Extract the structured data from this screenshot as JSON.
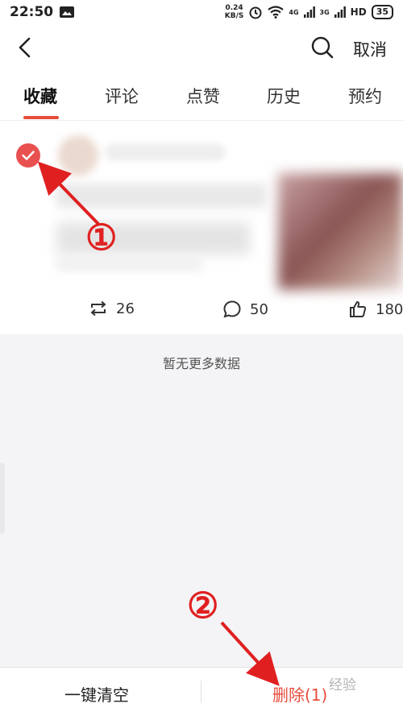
{
  "status": {
    "time": "22:50",
    "net_speed_top": "0.24",
    "net_speed_bottom": "KB/S",
    "sig1": "4G",
    "sig2": "3G",
    "hd": "HD",
    "battery": "35"
  },
  "header": {
    "cancel_label": "取消"
  },
  "tabs": [
    {
      "label": "收藏"
    },
    {
      "label": "评论"
    },
    {
      "label": "点赞"
    },
    {
      "label": "历史"
    },
    {
      "label": "预约"
    }
  ],
  "card": {
    "reposts": "26",
    "comments": "50",
    "likes": "180"
  },
  "list": {
    "end_text": "暂无更多数据"
  },
  "bottom": {
    "clear_label": "一键清空",
    "delete_label": "删除(1)"
  },
  "annotations": {
    "marker1": "①",
    "marker2": "②",
    "watermark": "经验"
  },
  "colors": {
    "accent": "#e74c3c",
    "checkbox": "#e85150",
    "annotation": "#e02020"
  }
}
